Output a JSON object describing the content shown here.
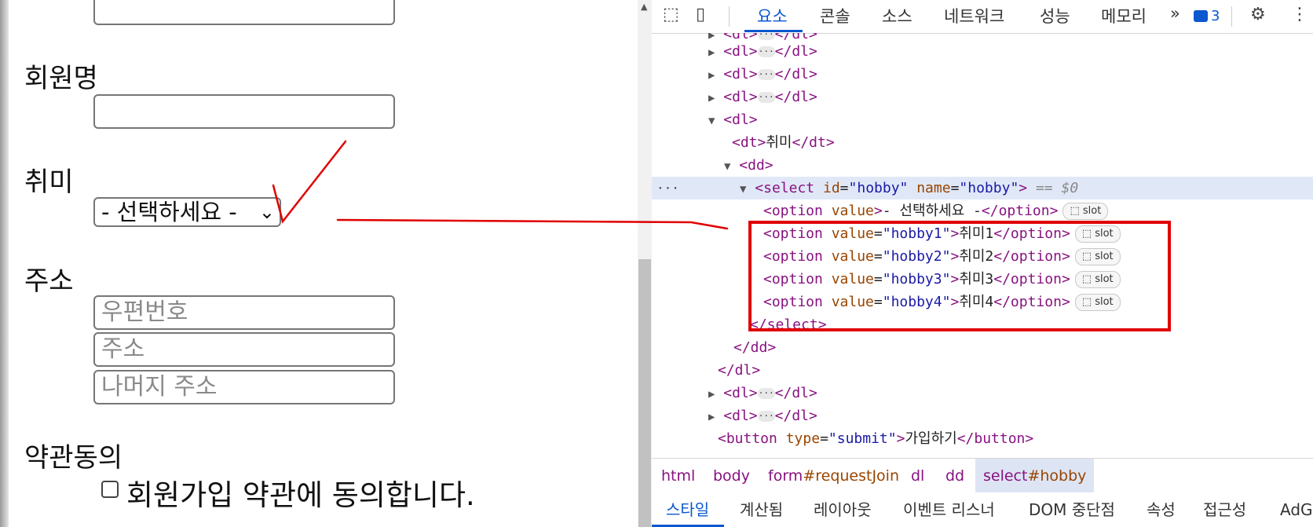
{
  "form": {
    "member_name_label": "회원명",
    "member_name_value": "",
    "hobby_label": "취미",
    "hobby_select_value": "- 선택하세요 -",
    "address_label": "주소",
    "postal_code_placeholder": "우편번호",
    "address_placeholder": "주소",
    "address_detail_placeholder": "나머지 주소",
    "terms_label": "약관동의",
    "terms_checkbox_text": "회원가입 약관에 동의합니다."
  },
  "devtools": {
    "tabs": [
      "요소",
      "콘솔",
      "소스",
      "네트워크",
      "성능",
      "메모리"
    ],
    "active_tab": "요소",
    "more_tabs": "»",
    "issues_count": "3",
    "elements": [
      {
        "text": "<dl>···</dl>"
      },
      {
        "text": "<dl>···</dl>"
      },
      {
        "text": "<dl>···</dl>"
      },
      {
        "text": "<dl>"
      },
      {
        "text": "<dt>취미</dt>"
      },
      {
        "text": "<dd>"
      },
      {
        "text": "<select id=\"hobby\" name=\"hobby\"> == $0"
      },
      {
        "text": "<option value>- 선택하세요 -</option>"
      },
      {
        "text": "<option value=\"hobby1\">취미1</option>"
      },
      {
        "text": "<option value=\"hobby2\">취미2</option>"
      },
      {
        "text": "<option value=\"hobby3\">취미3</option>"
      },
      {
        "text": "<option value=\"hobby4\">취미4</option>"
      },
      {
        "text": "</select>"
      },
      {
        "text": "</dd>"
      },
      {
        "text": "</dl>"
      },
      {
        "text": "<dl>···</dl>"
      },
      {
        "text": "<dl>···</dl>"
      },
      {
        "text": "<button type=\"submit\">가입하기</button>"
      }
    ],
    "slot_label": "slot",
    "breadcrumb": [
      {
        "tag": "html",
        "hash": ""
      },
      {
        "tag": "body",
        "hash": ""
      },
      {
        "tag": "form",
        "hash": "#requestJoin"
      },
      {
        "tag": "dl",
        "hash": ""
      },
      {
        "tag": "dd",
        "hash": ""
      },
      {
        "tag": "select",
        "hash": "#hobby"
      }
    ],
    "bottom_tabs": [
      "스타일",
      "계산됨",
      "레이아웃",
      "이벤트 리스너",
      "DOM 중단점",
      "속성",
      "접근성",
      "AdGu"
    ],
    "active_bottom_tab": "스타일"
  },
  "colors": {
    "accent": "#0b57d0",
    "annotation_red": "#e00000",
    "selected_row": "#e0e8f8",
    "tag": "#881280",
    "attr": "#994500",
    "value": "#1a1aa6"
  },
  "icons": [
    "inspect-element-icon",
    "device-toolbar-icon",
    "issues-icon",
    "settings-gear-icon",
    "more-menu-icon",
    "expand-triangle-icon",
    "collapse-triangle-icon",
    "select-chevron-icon"
  ]
}
